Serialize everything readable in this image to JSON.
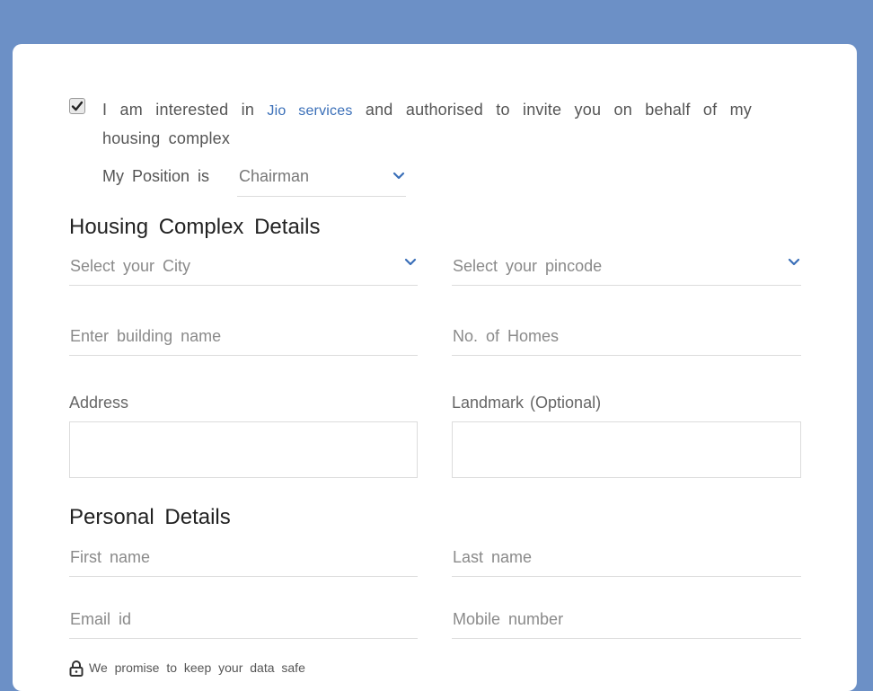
{
  "consent": {
    "checked": true,
    "text_before": "I am interested in ",
    "link_text": "Jio services",
    "text_after": " and authorised to invite you on behalf of my housing complex"
  },
  "position": {
    "label": "My Position is",
    "selected": "Chairman"
  },
  "housing": {
    "title": "Housing Complex Details",
    "city_placeholder": "Select your City",
    "pincode_placeholder": "Select your pincode",
    "building_placeholder": "Enter building name",
    "homes_placeholder": "No. of Homes",
    "address_label": "Address",
    "landmark_label": "Landmark (Optional)"
  },
  "personal": {
    "title": "Personal Details",
    "first_name_placeholder": "First name",
    "last_name_placeholder": "Last name",
    "email_placeholder": "Email id",
    "mobile_placeholder": "Mobile number"
  },
  "footer": {
    "safe_text": "We promise to keep your data safe"
  },
  "colors": {
    "background": "#6c90c6",
    "accent": "#3a6fb8"
  },
  "icons": {
    "checkbox": "check-icon",
    "dropdown": "chevron-down-icon",
    "privacy": "lock-icon"
  }
}
